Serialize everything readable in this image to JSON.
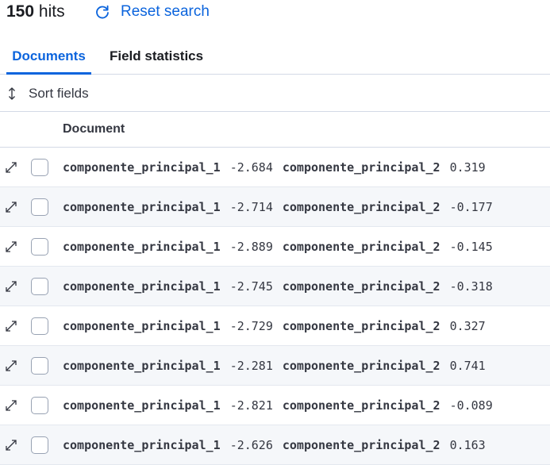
{
  "header": {
    "hits_count": "150",
    "hits_label": "hits",
    "reset_label": "Reset search"
  },
  "tabs": [
    {
      "label": "Documents",
      "active": true
    },
    {
      "label": "Field statistics",
      "active": false
    }
  ],
  "toolbar": {
    "sort_label": "Sort fields"
  },
  "table": {
    "column_header": "Document",
    "field_1": "componente_principal_1",
    "field_2": "componente_principal_2",
    "rows": [
      {
        "v1": "-2.684",
        "v2": "0.319"
      },
      {
        "v1": "-2.714",
        "v2": "-0.177"
      },
      {
        "v1": "-2.889",
        "v2": "-0.145"
      },
      {
        "v1": "-2.745",
        "v2": "-0.318"
      },
      {
        "v1": "-2.729",
        "v2": "0.327"
      },
      {
        "v1": "-2.281",
        "v2": "0.741"
      },
      {
        "v1": "-2.821",
        "v2": "-0.089"
      },
      {
        "v1": "-2.626",
        "v2": "0.163"
      }
    ]
  },
  "colors": {
    "accent": "#0b64dd",
    "text": "#1a1c21",
    "stripe": "#f5f7fa",
    "border": "#d3dae6"
  },
  "icons": {
    "reset": "refresh-icon",
    "sort": "sort-arrows-icon",
    "expand": "expand-diagonal-icon"
  }
}
